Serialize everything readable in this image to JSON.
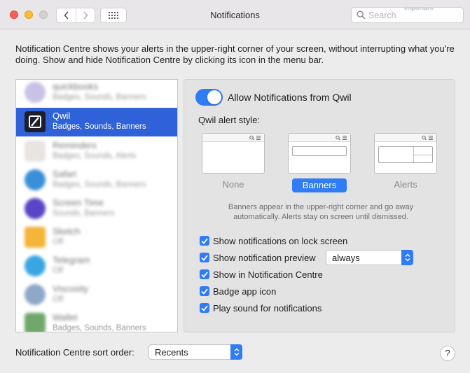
{
  "window": {
    "title": "Notifications"
  },
  "search": {
    "placeholder": "Search",
    "overflow_text": "important"
  },
  "description": "Notification Centre shows your alerts in the upper-right corner of your screen, without interrupting what you're doing. Show and hide Notification Centre by clicking its icon in the menu bar.",
  "apps": [
    {
      "name": "quickbooks",
      "sub": "Badges, Sounds, Banners",
      "blurred": true,
      "icon_color": "#c9c2e6"
    },
    {
      "name": "Qwil",
      "sub": "Badges, Sounds, Banners",
      "blurred": false,
      "selected": true,
      "icon_color": "#1d1d2b"
    },
    {
      "name": "Reminders",
      "sub": "Badges, Sounds, Alerts",
      "blurred": true,
      "icon_color": "#e7e4e2"
    },
    {
      "name": "Safari",
      "sub": "Badges, Sounds, Banners",
      "blurred": true,
      "icon_color": "#3a8fd8"
    },
    {
      "name": "Screen Time",
      "sub": "Sounds, Banners",
      "blurred": true,
      "icon_color": "#5a45c6"
    },
    {
      "name": "Sketch",
      "sub": "Off",
      "blurred": true,
      "icon_color": "#f5b43a"
    },
    {
      "name": "Telegram",
      "sub": "Off",
      "blurred": true,
      "icon_color": "#3aa5e3"
    },
    {
      "name": "Viscosity",
      "sub": "Off",
      "blurred": true,
      "icon_color": "#8fa8c8"
    },
    {
      "name": "Wallet",
      "sub": "Badges, Sounds, Banners",
      "blurred": true,
      "icon_color": "#6fa86a"
    }
  ],
  "settings": {
    "allow_label": "Allow Notifications from Qwil",
    "allow_enabled": true,
    "style_label": "Qwil alert style:",
    "styles": [
      {
        "name": "None",
        "selected": false
      },
      {
        "name": "Banners",
        "selected": true
      },
      {
        "name": "Alerts",
        "selected": false
      }
    ],
    "hint_line1": "Banners appear in the upper-right corner and go away",
    "hint_line2": "automatically. Alerts stay on screen until dismissed.",
    "options": [
      {
        "label": "Show notifications on lock screen",
        "checked": true
      },
      {
        "label": "Show notification preview",
        "checked": true
      },
      {
        "label": "Show in Notification Centre",
        "checked": true
      },
      {
        "label": "Badge app icon",
        "checked": true
      },
      {
        "label": "Play sound for notifications",
        "checked": true
      }
    ],
    "preview_value": "always"
  },
  "footer": {
    "sort_label": "Notification Centre sort order:",
    "sort_value": "Recents",
    "help": "?"
  },
  "colors": {
    "accent": "#2f7cf6",
    "selection": "#2f62d8"
  },
  "icons": [
    "back-icon",
    "forward-icon",
    "grid-icon",
    "search-icon",
    "checkmark-icon",
    "updown-arrows-icon"
  ]
}
